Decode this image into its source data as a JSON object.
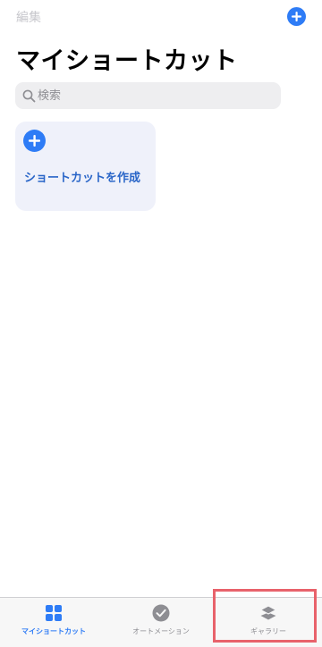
{
  "header": {
    "edit_label": "編集"
  },
  "page": {
    "title": "マイショートカット"
  },
  "search": {
    "placeholder": "検索",
    "value": ""
  },
  "create_card": {
    "label": "ショートカットを作成"
  },
  "tabs": [
    {
      "label": "マイショートカット",
      "icon": "grid-icon",
      "active": true
    },
    {
      "label": "オートメーション",
      "icon": "automation-check-icon",
      "active": false
    },
    {
      "label": "ギャラリー",
      "icon": "layers-icon",
      "active": false
    }
  ],
  "colors": {
    "accent": "#2e7cf6",
    "card_text": "#2a66c8",
    "card_background": "#eff1fa",
    "highlight": "#e8626b",
    "inactive_tab": "#8e8e93"
  }
}
